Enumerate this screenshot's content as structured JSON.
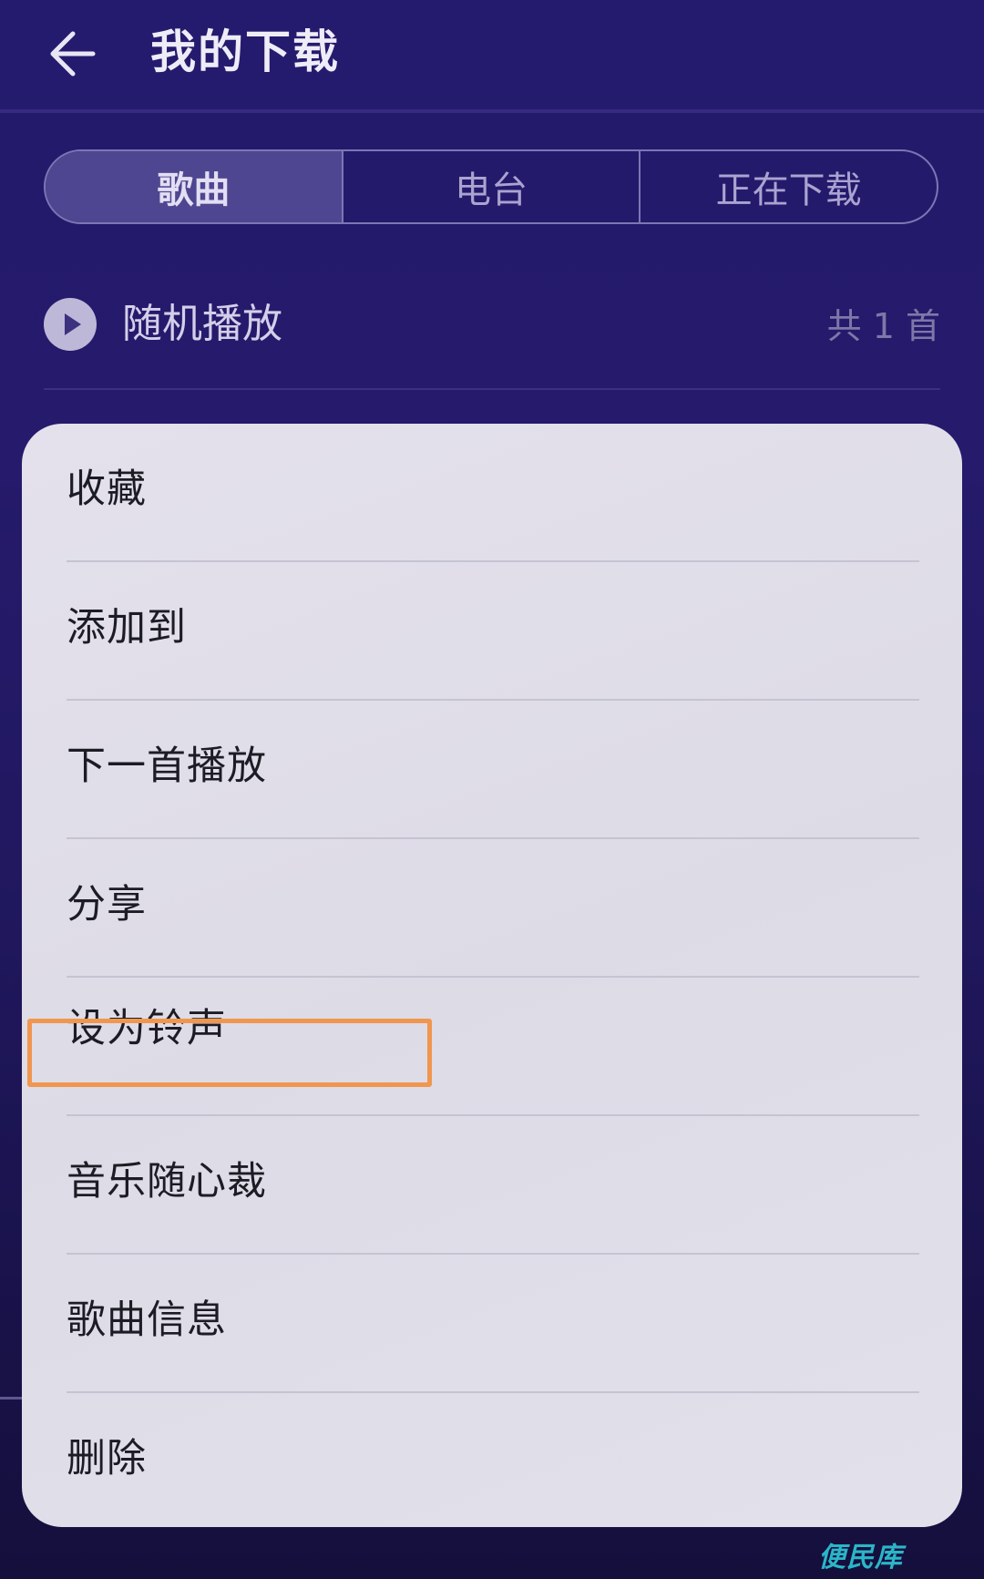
{
  "header": {
    "title": "我的下载",
    "back_icon": "arrow-left-icon"
  },
  "tabs": [
    {
      "label": "歌曲",
      "active": true
    },
    {
      "label": "电台",
      "active": false
    },
    {
      "label": "正在下载",
      "active": false
    }
  ],
  "shuffle": {
    "icon": "play-icon",
    "label": "随机播放",
    "count": "共 1 首"
  },
  "menu": {
    "items": [
      {
        "label": "收藏"
      },
      {
        "label": "添加到"
      },
      {
        "label": "下一首播放"
      },
      {
        "label": "分享"
      },
      {
        "label": "设为铃声"
      },
      {
        "label": "音乐随心裁"
      },
      {
        "label": "歌曲信息"
      },
      {
        "label": "删除"
      }
    ],
    "highlighted_item": "设为铃声"
  },
  "watermark": "便民库",
  "colors": {
    "background": "#241a6c",
    "sheet": "#e0dee8",
    "highlight": "#f0964e",
    "watermark": "#2ab6c8"
  }
}
